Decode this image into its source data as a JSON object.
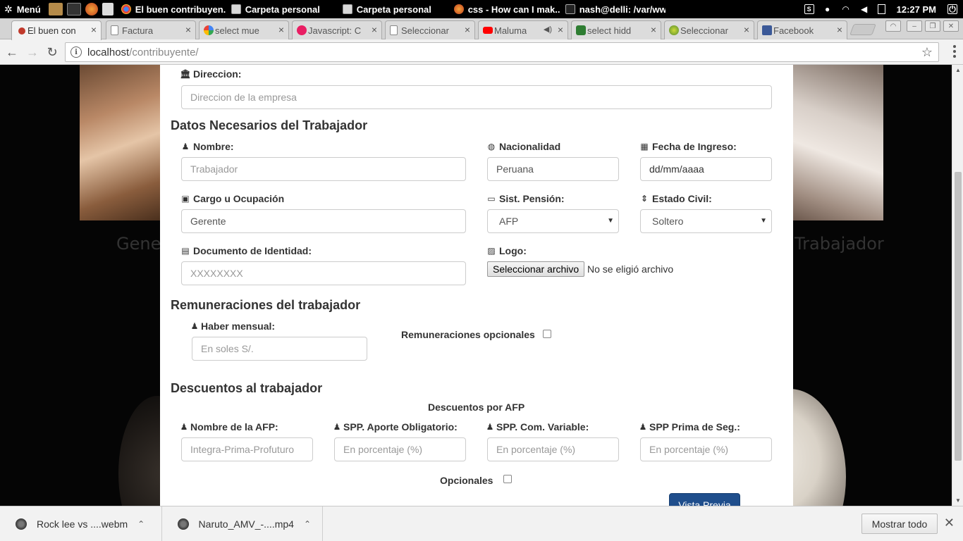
{
  "taskbar": {
    "menu_label": "Menú",
    "tasks": [
      {
        "label": "El buen contribuyen...",
        "color": "#e0a23b"
      },
      {
        "label": "Carpeta personal",
        "color": "#c9c9c9"
      },
      {
        "label": "Carpeta personal",
        "color": "#c9c9c9"
      },
      {
        "label": "css - How can I mak...",
        "color": "#e8661b"
      },
      {
        "label": "nash@delli: /var/ww...",
        "color": "#444444"
      }
    ],
    "clock": "12:27 PM"
  },
  "browser": {
    "tabs": [
      {
        "title": "El buen con",
        "favicon_color": "#c0392b",
        "active": true
      },
      {
        "title": "Factura",
        "favicon_color": "#cccccc",
        "active": false
      },
      {
        "title": "select mue",
        "favicon_color": "#4285f4",
        "active": false
      },
      {
        "title": "Javascript: C",
        "favicon_color": "#e91e63",
        "active": false
      },
      {
        "title": "Seleccionar",
        "favicon_color": "#cccccc",
        "active": false
      },
      {
        "title": "Maluma",
        "favicon_color": "#ff0000",
        "active": false
      },
      {
        "title": "select hidd",
        "favicon_color": "#2e7d32",
        "active": false
      },
      {
        "title": "Seleccionar",
        "favicon_color": "#8bc34a",
        "active": false
      },
      {
        "title": "Facebook",
        "favicon_color": "#3b5998",
        "active": false
      }
    ],
    "close_glyph": "×",
    "url_host": "localhost",
    "url_path": "/contribuyente/"
  },
  "background": {
    "caption_left": "Gene",
    "caption_right": "Trabajador"
  },
  "form": {
    "direccion": {
      "label": "Direccion:",
      "placeholder": "Direccion de la empresa"
    },
    "section_trabajador": "Datos Necesarios del Trabajador",
    "nombre": {
      "label": "Nombre:",
      "placeholder": "Trabajador"
    },
    "nacionalidad": {
      "label": "Nacionalidad",
      "value": "Peruana"
    },
    "fecha_ingreso": {
      "label": "Fecha de Ingreso:",
      "value": "dd/mm/aaaa"
    },
    "cargo": {
      "label": "Cargo u Ocupación",
      "value": "Gerente"
    },
    "sist_pension": {
      "label": "Sist. Pensión:",
      "value": "AFP"
    },
    "estado_civil": {
      "label": "Estado Civil:",
      "value": "Soltero"
    },
    "documento": {
      "label": "Documento de Identidad:",
      "placeholder": "XXXXXXXX"
    },
    "logo": {
      "label": "Logo:",
      "button": "Seleccionar archivo",
      "status": "No se eligió archivo"
    },
    "section_remuneraciones": "Remuneraciones del trabajador",
    "haber_mensual": {
      "label": "Haber mensual:",
      "placeholder": "En soles S/."
    },
    "remuneraciones_opcionales": {
      "label": "Remuneraciones opcionales",
      "checked": false
    },
    "section_descuentos": "Descuentos al trabajador",
    "descuentos_afp_title": "Descuentos por AFP",
    "nombre_afp": {
      "label": "Nombre de la AFP:",
      "placeholder": "Integra-Prima-Profuturo"
    },
    "spp_aporte": {
      "label": "SPP. Aporte Obligatorio:",
      "placeholder": "En porcentaje (%)"
    },
    "spp_comision": {
      "label": "SPP. Com. Variable:",
      "placeholder": "En porcentaje (%)"
    },
    "spp_prima": {
      "label": "SPP Prima de Seg.:",
      "placeholder": "En porcentaje (%)"
    },
    "opcionales": {
      "label": "Opcionales",
      "checked": false
    },
    "vista_previa": "Vista Previa"
  },
  "downloads": {
    "items": [
      {
        "name": "Rock lee vs ....webm"
      },
      {
        "name": "Naruto_AMV_-....mp4"
      }
    ],
    "show_all": "Mostrar todo"
  },
  "colors": {
    "primary_button": "#1f4e8c",
    "taskbar_bg": "#000000"
  }
}
